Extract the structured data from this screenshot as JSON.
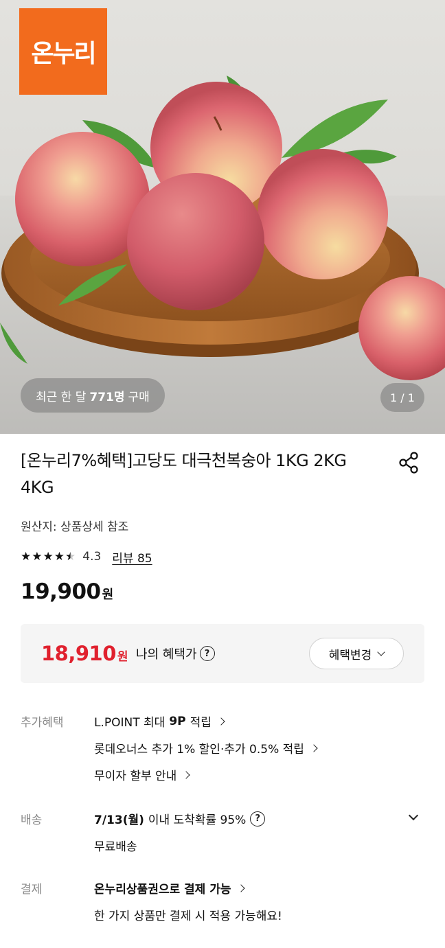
{
  "hero": {
    "logo_text": "온누리",
    "logo_color": "#f26b1d",
    "buyers_prefix": "최근 한 달",
    "buyers_count": "771명",
    "buyers_suffix": "구매",
    "pager": "1 / 1"
  },
  "product": {
    "title": "[온누리7%혜택]고당도 대극천복숭아 1KG 2KG 4KG",
    "origin": "원산지: 상품상세 참조",
    "rating": 4.3,
    "rating_text": "4.3",
    "review_label": "리뷰 85",
    "price_amount": "19,900",
    "price_unit": "원"
  },
  "benefit": {
    "price_amount": "18,910",
    "price_unit": "원",
    "label": "나의 혜택가",
    "help": "?",
    "change_button": "혜택변경",
    "accent_color": "#e0212e"
  },
  "extra_benefits": {
    "label": "추가혜택",
    "lpoint_prefix": "L.POINT 최대",
    "lpoint_value": "9P",
    "lpoint_suffix": "적립",
    "lotte_members": "롯데오너스 추가 1% 할인·추가 0.5% 적립",
    "installment": "무이자 할부 안내"
  },
  "delivery": {
    "label": "배송",
    "date": "7/13(월)",
    "arrival_text": "이내 도착확률 95%",
    "help": "?",
    "fee": "무료배송"
  },
  "payment": {
    "label": "결제",
    "method": "온누리상품권으로 결제 가능",
    "note": "한 가지 상품만 결제 시 적용 가능해요!"
  }
}
